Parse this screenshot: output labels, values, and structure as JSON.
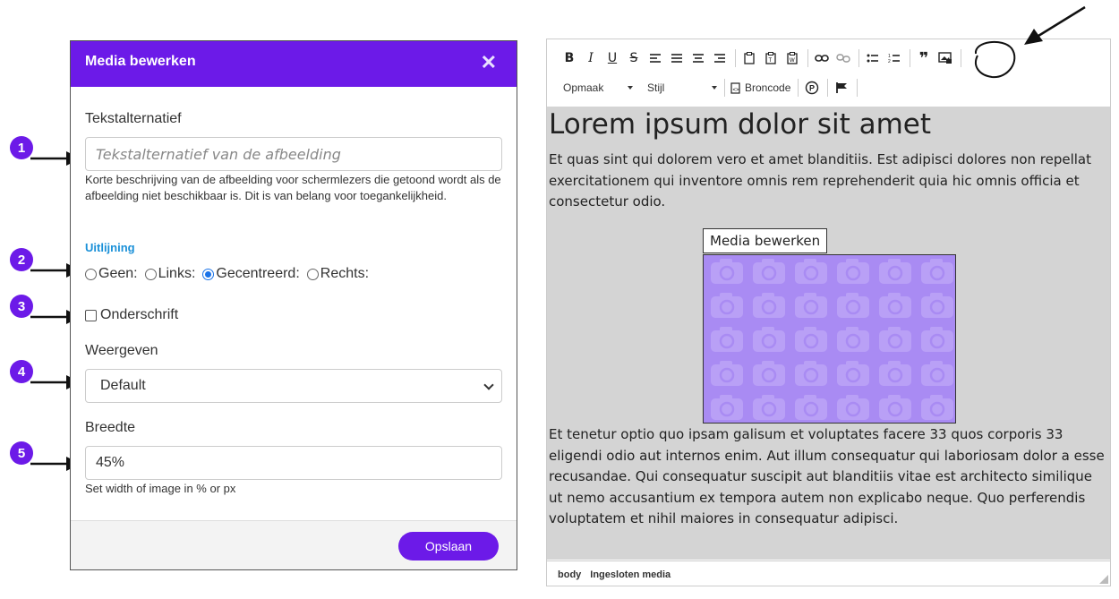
{
  "dialog": {
    "title": "Media bewerken",
    "close_icon": "close-icon",
    "alt_label": "Tekstalternatief",
    "alt_placeholder": "Tekstalternatief van de afbeelding",
    "alt_help": "Korte beschrijving van de afbeelding voor schermlezers die getoond wordt als de afbeelding niet beschikbaar is. Dit is van belang voor toegankelijkheid.",
    "alignment_title": "Uitlijning",
    "alignment_options": [
      "Geen:",
      "Links:",
      "Gecentreerd:",
      "Rechts:"
    ],
    "alignment_selected": "Gecentreerd:",
    "caption_label": "Onderschrift",
    "display_label": "Weergeven",
    "display_value": "Default",
    "width_label": "Breedte",
    "width_value": "45%",
    "width_help": "Set width of image in % or px",
    "save_label": "Opslaan"
  },
  "callouts": [
    "1",
    "2",
    "3",
    "4",
    "5"
  ],
  "editor": {
    "toolbar_row1": [
      "B",
      "I",
      "U",
      "S"
    ],
    "format_combo": "Opmaak",
    "style_combo": "Stijl",
    "source_button": "Broncode",
    "heading": "Lorem ipsum dolor sit amet",
    "paragraph1": "Et quas sint qui dolorem vero et amet blanditiis. Est adipisci dolores non repellat exercitationem qui inventore omnis rem reprehenderit quia hic omnis officia et consectetur odio.",
    "media_tag": "Media bewerken",
    "paragraph2": "Et tenetur optio quo ipsam galisum et voluptates facere 33 quos corporis 33 eligendi odio aut internos enim. Aut illum consequatur qui laboriosam dolor a esse recusandae. Qui consequatur suscipit aut blanditiis vitae est architecto similique ut nemo accusantium ex tempora autem non explicabo neque. Quo perferendis voluptatem et nihil maiores in consequatur adipisci.",
    "status_path": [
      "body",
      "Ingesloten media"
    ]
  },
  "colors": {
    "brand": "#6c1ae8",
    "section_title": "#1a90d8",
    "content_bg": "#d4d4d4",
    "image_bg": "#a98bf3"
  }
}
